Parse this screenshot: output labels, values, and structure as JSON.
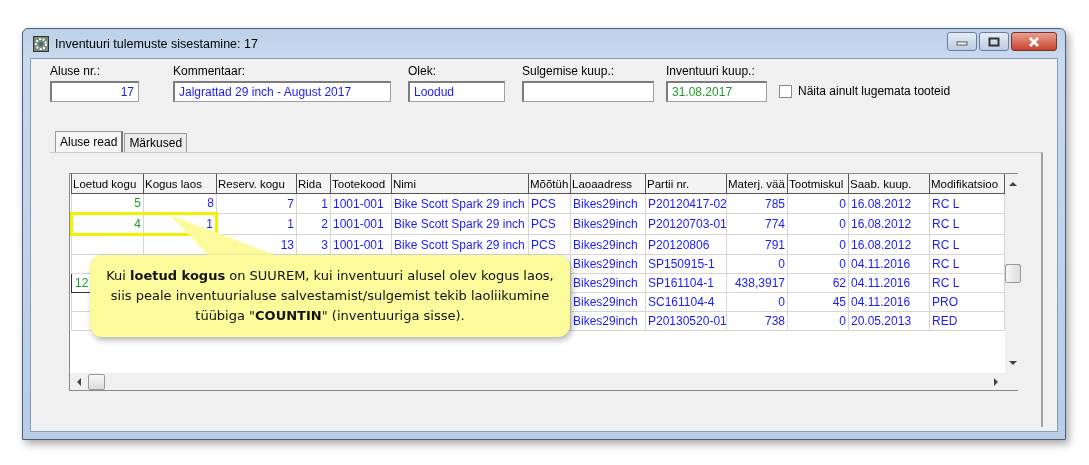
{
  "window": {
    "title": "Inventuuri tulemuste sisestamine: 17"
  },
  "fields": [
    {
      "label": "Aluse nr.:",
      "value": "17",
      "color": "#1a1aff"
    },
    {
      "label": "Kommentaar:",
      "value": "Jalgrattad 29 inch - August 2017",
      "color": "#1a1aff"
    },
    {
      "label": "Olek:",
      "value": "Loodud",
      "color": "#1a1aff"
    },
    {
      "label": "Sulgemise kuup.:"
    },
    {
      "label": "Inventuuri kuup.:",
      "value": "31.08.2017",
      "color": "#1e9a2a"
    }
  ],
  "filter_checkbox": {
    "label": "Näita ainult lugemata tooteid",
    "checked": false
  },
  "tabs": [
    {
      "label": "Aluse read",
      "selected": true
    },
    {
      "label": "Märkused",
      "selected": false
    }
  ],
  "grid": {
    "columns": [
      {
        "label": "Loetud kogu",
        "kind": "counted"
      },
      {
        "label": "Kogus laos",
        "kind": "data"
      },
      {
        "label": "Reserv. kogu",
        "kind": "data"
      },
      {
        "label": "Rida",
        "kind": "data"
      },
      {
        "label": "Tootekood",
        "kind": "data"
      },
      {
        "label": "Nimi",
        "kind": "data"
      },
      {
        "label": "Mõõtüh",
        "kind": "data"
      },
      {
        "label": "Laoaadress",
        "kind": "data"
      },
      {
        "label": "Partii nr.",
        "kind": "data"
      },
      {
        "label": "Materj. vää",
        "kind": "data"
      },
      {
        "label": "Tootmiskul",
        "kind": "data"
      },
      {
        "label": "Saab. kuup.",
        "kind": "data"
      },
      {
        "label": "Modifikatsioo",
        "kind": "data"
      }
    ],
    "rows": [
      {
        "highlighted": false,
        "cells": [
          "5",
          "8",
          "7",
          "1",
          "1001-001",
          "Bike Scott Spark 29 inch",
          "PCS",
          "Bikes29inch",
          "P20120417-02",
          "785",
          "0",
          "16.08.2012",
          "RC L"
        ]
      },
      {
        "highlighted": true,
        "cells": [
          "4",
          "1",
          "1",
          "2",
          "1001-001",
          "Bike Scott Spark 29 inch",
          "PCS",
          "Bikes29inch",
          "P20120703-01",
          "774",
          "0",
          "16.08.2012",
          "RC L"
        ]
      },
      {
        "highlighted": false,
        "cells": [
          null,
          null,
          "13",
          "3",
          "1001-001",
          "Bike Scott Spark 29 inch",
          "PCS",
          "Bikes29inch",
          "P20120806",
          "791",
          "0",
          "16.08.2012",
          "RC L"
        ]
      },
      {
        "highlighted": false,
        "cells": [
          null,
          null,
          null,
          null,
          null,
          null,
          null,
          "Bikes29inch",
          "SP150915-1",
          "0",
          "0",
          "04.11.2016",
          "RC L"
        ]
      },
      {
        "highlighted": false,
        "editing": true,
        "cells": [
          "12",
          null,
          null,
          null,
          null,
          null,
          null,
          "Bikes29inch",
          "SP161104-1",
          "438,3917",
          "62",
          "04.11.2016",
          "RC L"
        ]
      },
      {
        "highlighted": false,
        "cells": [
          null,
          null,
          null,
          null,
          null,
          null,
          null,
          "Bikes29inch",
          "SC161104-4",
          "0",
          "45",
          "04.11.2016",
          "PRO"
        ]
      },
      {
        "highlighted": false,
        "cells": [
          null,
          null,
          null,
          null,
          null,
          null,
          null,
          "Bikes29inch",
          "P20130520-01",
          "738",
          "0",
          "20.05.2013",
          "RED"
        ]
      }
    ]
  },
  "callout": {
    "text": "Kui **loetud kogus** on SUUREM, kui inventuuri alusel olev kogus laos, siis peale inventuurialuse salvestamist/sulgemist tekib laoliikumine tüübiga \"**COUNTIN**\" (inventuuriga sisse)."
  }
}
